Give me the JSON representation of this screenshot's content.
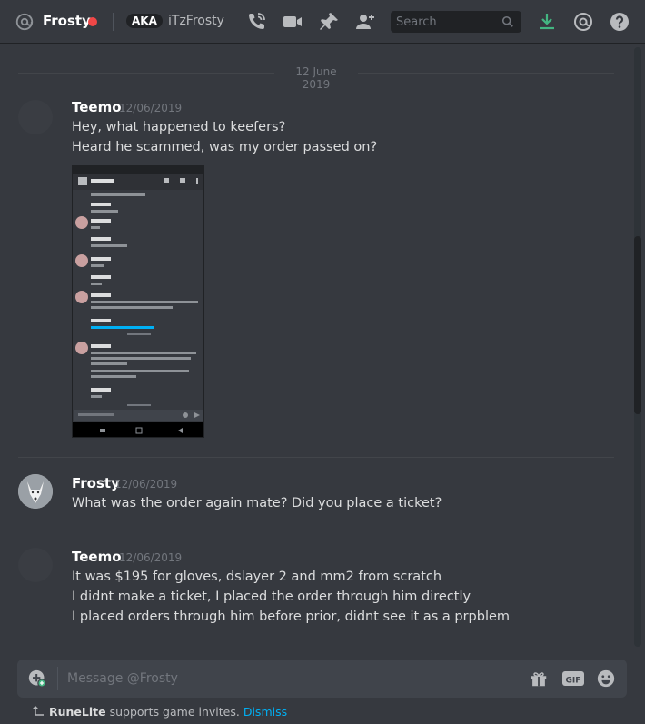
{
  "header": {
    "dm_name": "Frosty",
    "aka_badge": "AKA",
    "aka_name": "iTzFrosty",
    "search_placeholder": "Search",
    "status_color": "#f04747"
  },
  "date_separator": "12 June 2019",
  "messages": [
    {
      "author": "Teemo",
      "timestamp": "12/06/2019",
      "lines": [
        "Hey, what happened to keefers?",
        "Heard he scammed, was my order passed on?"
      ],
      "has_attachment": true
    },
    {
      "author": "Frosty",
      "timestamp": "12/06/2019",
      "lines": [
        "What was the order again mate? Did you place a ticket?"
      ]
    },
    {
      "author": "Teemo",
      "timestamp": "12/06/2019",
      "lines": [
        "It was $195 for gloves, dslayer 2 and mm2 from scratch",
        "I didnt make a ticket, I placed the order through him directly",
        "I placed orders through him before prior, didnt see it as a prpblem"
      ]
    }
  ],
  "composer": {
    "placeholder": "Message @Frosty",
    "gif_label": "GIF"
  },
  "notice": {
    "app": "RuneLite",
    "text": "supports game invites.",
    "dismiss": "Dismiss"
  },
  "icons": [
    "at-icon",
    "phone-icon",
    "video-icon",
    "pin-icon",
    "add-friend-icon",
    "search-icon",
    "download-icon",
    "mentions-icon",
    "help-icon",
    "add-attachment-icon",
    "gift-icon",
    "gif-icon",
    "emoji-icon"
  ]
}
